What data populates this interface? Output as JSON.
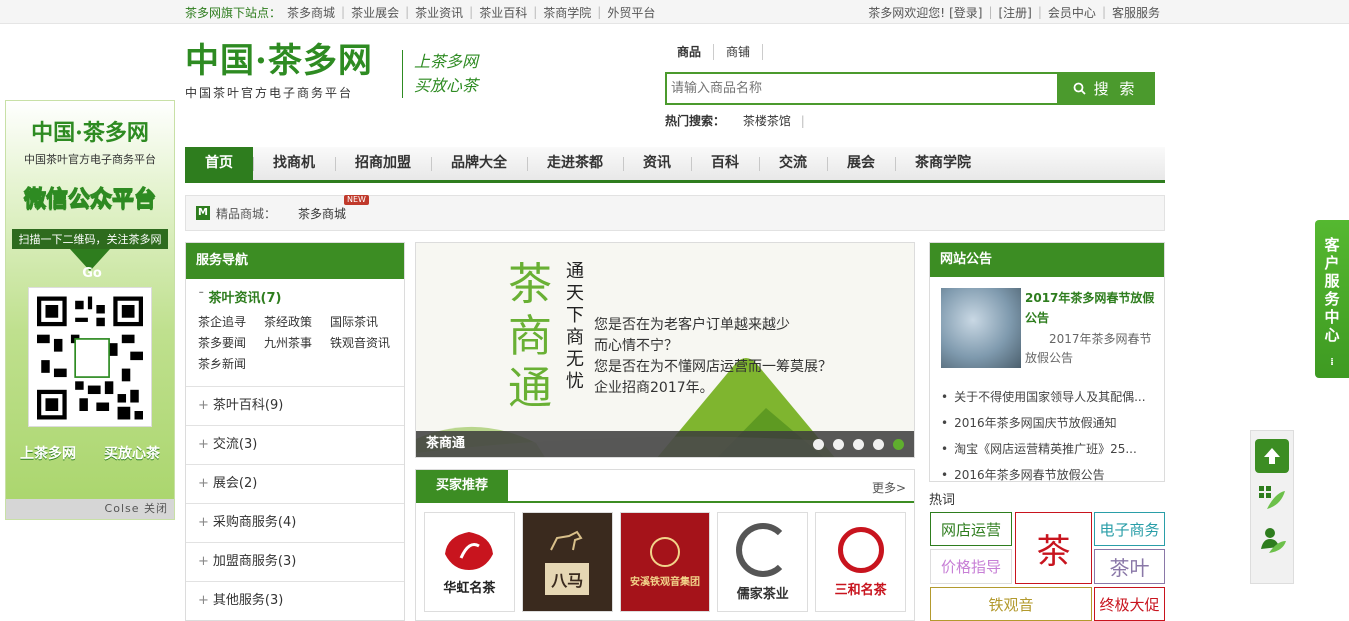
{
  "topbar": {
    "sites_label": "茶多网旗下站点：",
    "sites": [
      "茶多商城",
      "茶业展会",
      "茶业资讯",
      "茶业百科",
      "茶商学院",
      "外贸平台"
    ],
    "welcome": "茶多网欢迎您!",
    "login": "[登录]",
    "register": "[注册]",
    "member": "会员中心",
    "service": "客服服务"
  },
  "header": {
    "logo_title": "中国·茶多网",
    "logo_subtitle": "中国茶叶官方电子商务平台",
    "slogan_line1": "上茶多网",
    "slogan_line2": "买放心茶"
  },
  "search": {
    "tabs": [
      "商品",
      "商铺"
    ],
    "placeholder": "请输入商品名称",
    "button": "搜 索",
    "hot_label": "热门搜索：",
    "hot_item": "茶楼茶馆"
  },
  "nav": {
    "items": [
      "首页",
      "找商机",
      "招商加盟",
      "品牌大全",
      "走进茶都",
      "资讯",
      "百科",
      "交流",
      "展会",
      "茶商学院"
    ]
  },
  "mall": {
    "icon": "M",
    "label": "精品商城：",
    "link": "茶多商城",
    "badge": "NEW"
  },
  "left_ad": {
    "title": "中国·茶多网",
    "subtitle": "中国茶叶官方电子商务平台",
    "heading": "微信公众平台",
    "scan_text": "扫描一下二维码，关注茶多网",
    "go": "Go",
    "slogan_left": "上茶多网",
    "slogan_right": "买放心茶",
    "close": "Colse 关闭"
  },
  "service_nav": {
    "title": "服务导航",
    "open_group": {
      "label": "茶叶资讯(7)",
      "items": [
        "茶企追寻",
        "茶经政策",
        "国际茶讯",
        "茶多要闻",
        "九州茶事",
        "铁观音资讯",
        "茶乡新闻"
      ]
    },
    "groups": [
      "茶叶百科(9)",
      "交流(3)",
      "展会(2)",
      "采购商服务(4)",
      "加盟商服务(3)",
      "其他服务(3)"
    ]
  },
  "banner": {
    "big_text": "茶商通",
    "vertical_text": "通天下商无忧",
    "line1": "您是否在为老客户订单越来越少",
    "line2": "而心情不宁？",
    "line3": "您是否在为不懂网店运营而一筹莫展？",
    "line4": "企业招商2017年。",
    "caption": "茶商通",
    "slide_count": 5,
    "active_slide": 5
  },
  "buyers": {
    "title": "买家推荐",
    "more": "更多>",
    "logos": [
      {
        "name": "华虹名茶",
        "color": "#c8141e"
      },
      {
        "name": "八马",
        "color": "#3a2a1e"
      },
      {
        "name": "安溪铁观音集团",
        "color": "#a5131a"
      },
      {
        "name": "儒家茶业",
        "color": "#333333"
      },
      {
        "name": "三和名茶",
        "color": "#c8141e"
      }
    ]
  },
  "notices": {
    "title": "网站公告",
    "featured_title": "2017年茶多网春节放假公告",
    "featured_desc": "2017年茶多网春节放假公告",
    "items": [
      "关于不得使用国家领导人及其配偶...",
      "2016年茶多网国庆节放假通知",
      "淘宝《网店运营精英推广班》25...",
      "2016年茶多网春节放假公告"
    ]
  },
  "hot_words": {
    "label": "热词",
    "tags": [
      {
        "text": "网店运营",
        "color": "#2e7d1e"
      },
      {
        "text": "茶",
        "color": "#c8141e"
      },
      {
        "text": "电子商务",
        "color": "#2a9ea8"
      },
      {
        "text": "价格指导",
        "color": "#c77fd6"
      },
      {
        "text": "茶叶",
        "color": "#8a78a8"
      },
      {
        "text": "铁观音",
        "color": "#b39a2e"
      },
      {
        "text": "终极大促",
        "color": "#c8141e"
      }
    ]
  },
  "right": {
    "customer_service": "客户服务中心",
    "tools": [
      "back-to-top-icon",
      "app-grid-icon",
      "user-service-icon"
    ]
  },
  "colors": {
    "brand_green": "#2e7d1e",
    "accent_green": "#3c8d23",
    "light_green": "#69b034"
  }
}
